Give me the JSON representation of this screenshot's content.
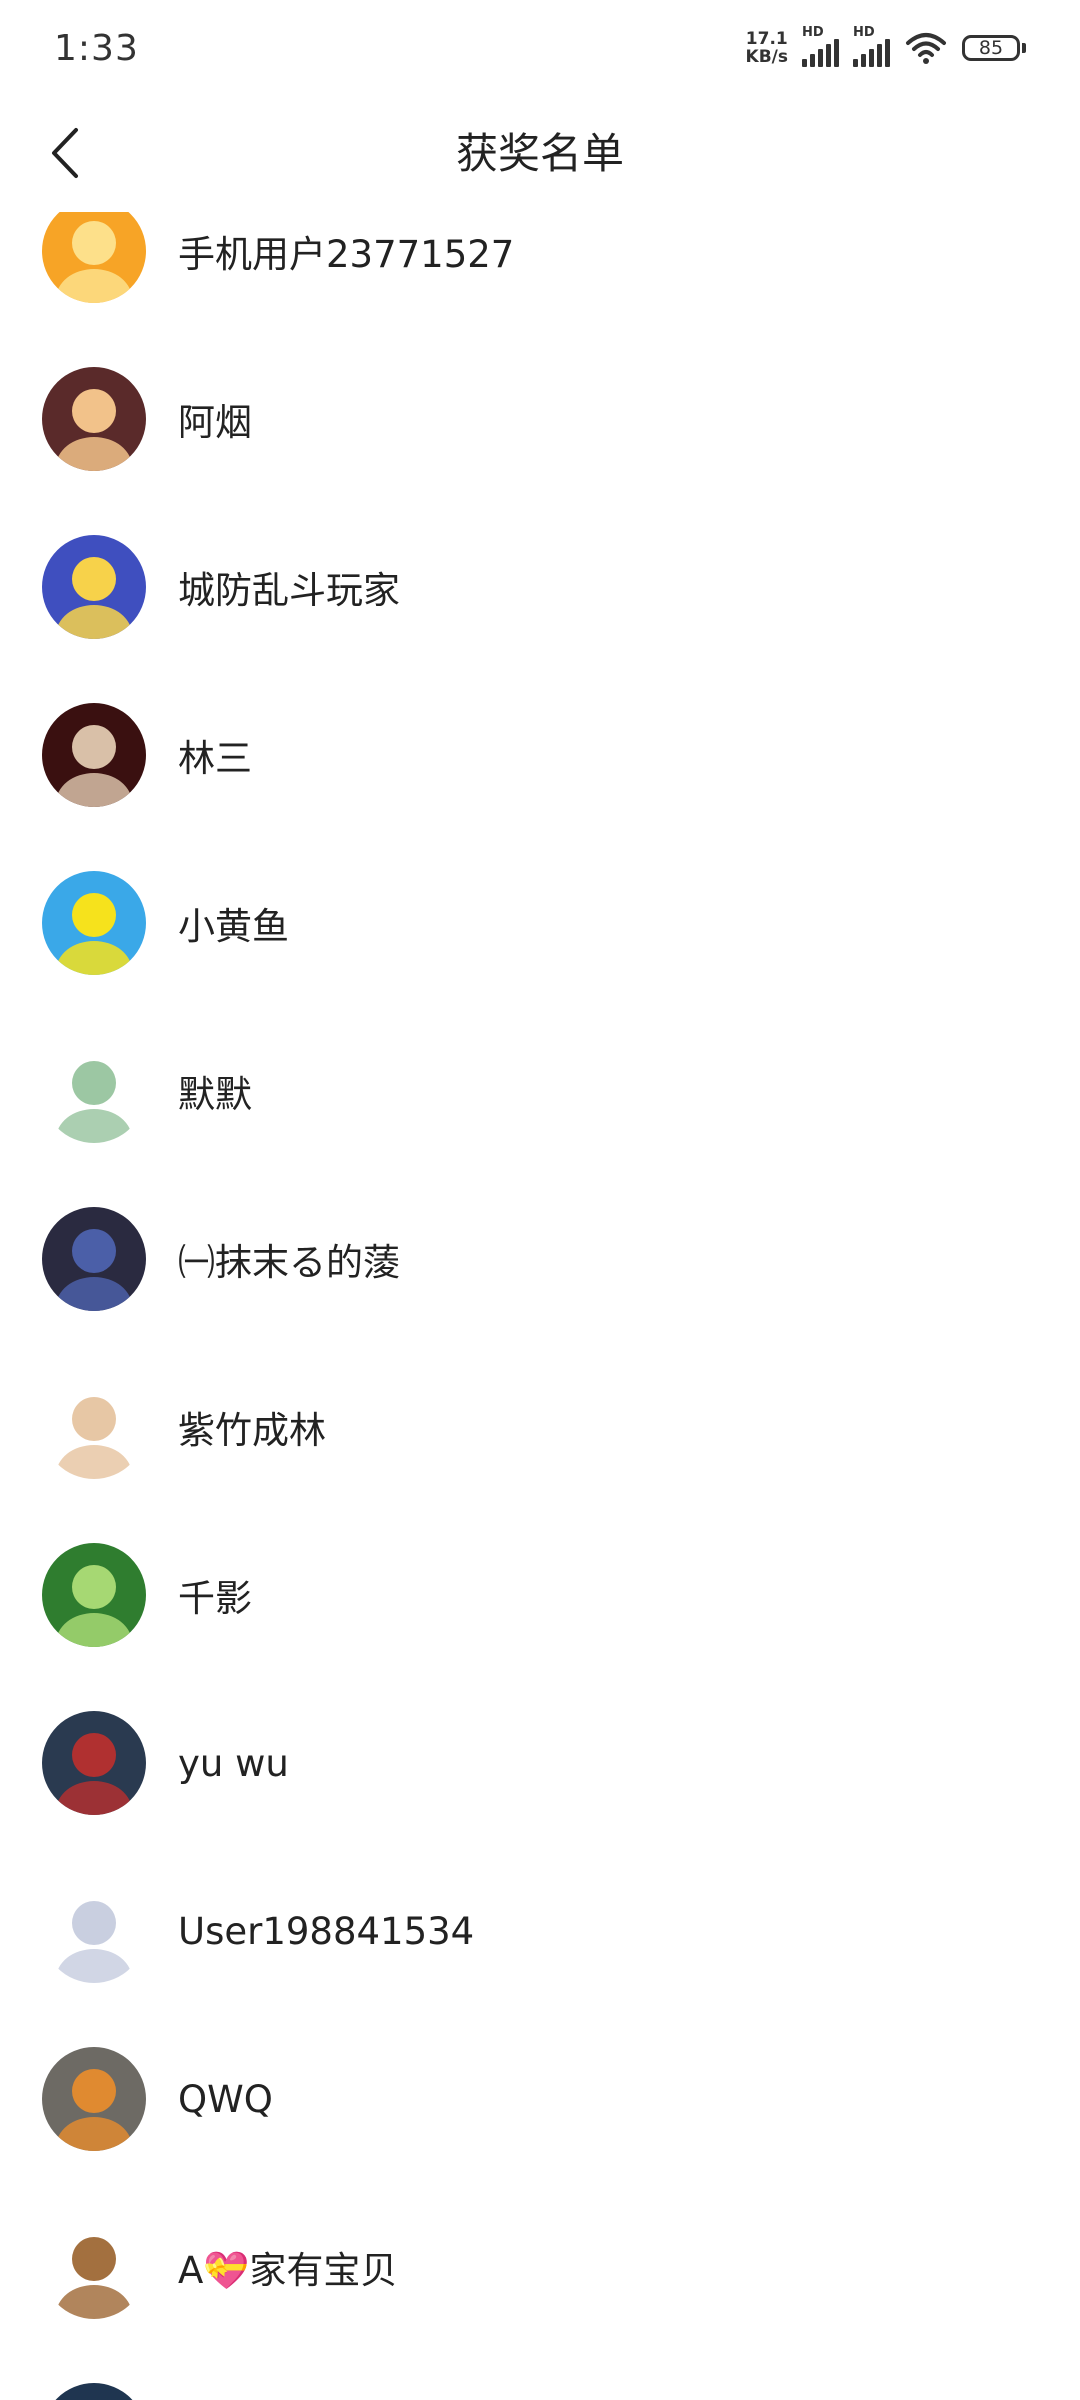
{
  "status_bar": {
    "time": "1:33",
    "net_speed_value": "17.1",
    "net_speed_unit": "KB/s",
    "sim1_label": "HD",
    "sim2_label": "HD",
    "battery": "85"
  },
  "header": {
    "title": "获奖名单",
    "back_icon": "chevron-left-icon"
  },
  "winners": [
    {
      "name": "手机用户23771527",
      "avatar_colors": [
        "#f7a426",
        "#fde08a"
      ]
    },
    {
      "name": "阿烟",
      "avatar_colors": [
        "#5a2a2a",
        "#f2c28a"
      ]
    },
    {
      "name": "城防乱斗玩家",
      "avatar_colors": [
        "#3f4fbf",
        "#f7d24a"
      ]
    },
    {
      "name": "林三",
      "avatar_colors": [
        "#3a1010",
        "#d9c0a8"
      ]
    },
    {
      "name": "小黄鱼",
      "avatar_colors": [
        "#3aa8e8",
        "#f6e21c"
      ]
    },
    {
      "name": "默默",
      "avatar_colors": [
        "#ffffff",
        "#9cc7a3"
      ]
    },
    {
      "name": "㈠抹末る的蔆",
      "avatar_colors": [
        "#2a2a40",
        "#4b5fa8"
      ]
    },
    {
      "name": "紫竹成林",
      "avatar_colors": [
        "#ffffff",
        "#e7c7a5"
      ]
    },
    {
      "name": "千影",
      "avatar_colors": [
        "#2f7d2f",
        "#a6d873"
      ]
    },
    {
      "name": "yu wu",
      "avatar_colors": [
        "#2a3a50",
        "#b03030"
      ]
    },
    {
      "name": "User198841534",
      "avatar_colors": [
        "#ffffff",
        "#c9cfe0"
      ]
    },
    {
      "name": "QWQ",
      "avatar_colors": [
        "#6d6a64",
        "#e08a30"
      ]
    },
    {
      "name": "A💝家有宝贝",
      "avatar_colors": [
        "#ffffff",
        "#a3703f"
      ]
    },
    {
      "name": "",
      "avatar_colors": [
        "#1f3550",
        "#2a4a6a"
      ]
    }
  ]
}
